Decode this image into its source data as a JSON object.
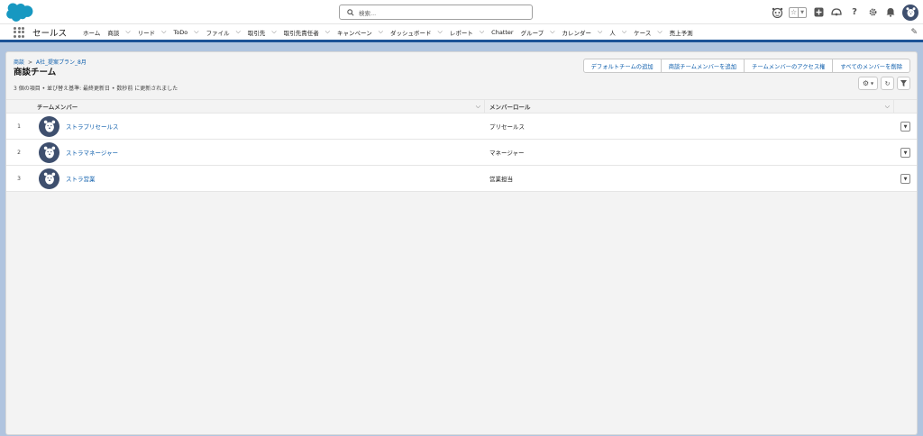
{
  "search": {
    "placeholder": "検索..."
  },
  "nav": {
    "app_name": "セールス",
    "items": [
      {
        "label": "ホーム",
        "has_menu": false
      },
      {
        "label": "商談",
        "has_menu": true
      },
      {
        "label": "リード",
        "has_menu": true
      },
      {
        "label": "ToDo",
        "has_menu": true
      },
      {
        "label": "ファイル",
        "has_menu": true
      },
      {
        "label": "取引先",
        "has_menu": true
      },
      {
        "label": "取引先責任者",
        "has_menu": true
      },
      {
        "label": "キャンペーン",
        "has_menu": true
      },
      {
        "label": "ダッシュボード",
        "has_menu": true
      },
      {
        "label": "レポート",
        "has_menu": true
      },
      {
        "label": "Chatter",
        "has_menu": false
      },
      {
        "label": "グループ",
        "has_menu": true
      },
      {
        "label": "カレンダー",
        "has_menu": true
      },
      {
        "label": "人",
        "has_menu": true
      },
      {
        "label": "ケース",
        "has_menu": true
      },
      {
        "label": "売上予測",
        "has_menu": false
      }
    ]
  },
  "header": {
    "breadcrumb_parent": "商談",
    "breadcrumb_separator": ">",
    "breadcrumb_record": "A社_提案プラン_8月",
    "title": "商談チーム",
    "meta": "3 個の項目 • 並び替え基準: 最終更新日 • 数秒前 に更新されました"
  },
  "actions": {
    "add_default_team": "デフォルトチームの追加",
    "add_members": "商談チームメンバーを追加",
    "member_access": "チームメンバーのアクセス権",
    "remove_all": "すべてのメンバーを削除"
  },
  "table": {
    "columns": [
      "チームメンバー",
      "メンバーロール"
    ],
    "rows": [
      {
        "num": "1",
        "member": "ストラプリセールス",
        "role": "プリセールス"
      },
      {
        "num": "2",
        "member": "ストラマネージャー",
        "role": "マネージャー"
      },
      {
        "num": "3",
        "member": "ストラ営業",
        "role": "営業担当"
      }
    ]
  },
  "colors": {
    "brand": "#1b5297",
    "link": "#0b5cab",
    "logo": "#1798c1",
    "avatar": "#3e4f6e",
    "background": "#b0c4df"
  }
}
